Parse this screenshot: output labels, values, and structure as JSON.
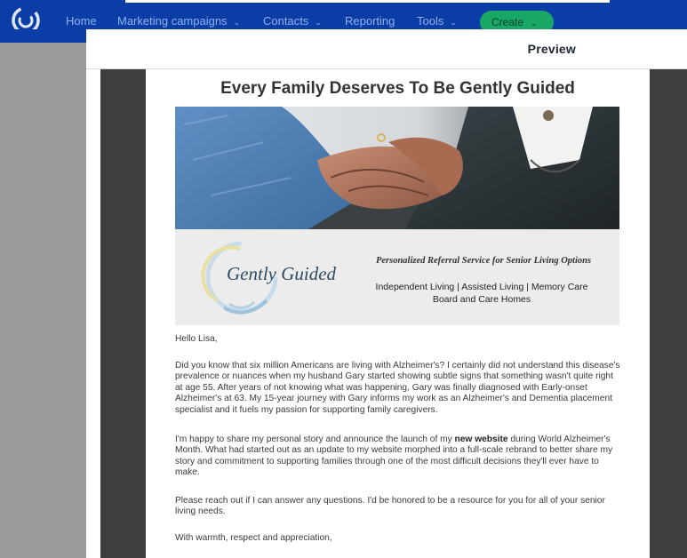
{
  "topnav": {
    "items": [
      {
        "label": "Home",
        "has_menu": false
      },
      {
        "label": "Marketing campaigns",
        "has_menu": true
      },
      {
        "label": "Contacts",
        "has_menu": true
      },
      {
        "label": "Reporting",
        "has_menu": false
      },
      {
        "label": "Tools",
        "has_menu": true
      }
    ],
    "create_label": "Create",
    "chevron": "⌄"
  },
  "preview": {
    "title": "Preview"
  },
  "email": {
    "title": "Every Family Deserves To Be Gently Guided",
    "banner": {
      "brand": "Gently Guided",
      "tagline": "Personalized Referral Service for Senior Living Options",
      "services_line1": "Independent Living | Assisted Living | Memory Care",
      "services_line2": "Board and Care Homes"
    },
    "greeting": "Hello Lisa,",
    "paragraph1": "Did you know that six million Americans are living with Alzheimer's? I certainly did not understand this disease's prevalence or nuances when my husband Gary started showing subtle signs that something wasn't quite right at age 55. After years of not knowing what was happening, Gary was finally diagnosed with Early-onset Alzheimer's at 63. My 15-year journey with Gary informs my work as an Alzheimer's and Dementia placement specialist and it fuels my passion for supporting family caregivers.",
    "paragraph2_before": "I'm happy to share my personal story and announce the launch of my ",
    "paragraph2_link": "new website",
    "paragraph2_after": " during World Alzheimer's Month. What had started out as an update to my website morphed into a full-scale rebrand to better share my story and commitment to supporting families through one of the most difficult decisions they'll ever have to make.",
    "paragraph3": "Please reach out if I can answer any questions. I'd be honored to be a resource for you for all of your senior living needs.",
    "signoff": "With warmth, respect and appreciation,"
  },
  "colors": {
    "nav_bg": "#0a3da6",
    "nav_text": "#8fb2ee",
    "create_bg": "#18a764",
    "canvas_dark": "#3d3e40",
    "side_gray": "#999b9d"
  },
  "icons": {
    "app_logo": "constant-contact-logo-icon",
    "menu_chevron": "chevron-down-icon"
  }
}
